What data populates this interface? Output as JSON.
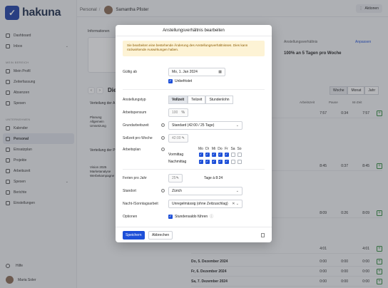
{
  "app": {
    "name": "hakuna"
  },
  "sidebar": {
    "items": [
      {
        "label": "Dashboard"
      },
      {
        "label": "Inbox"
      }
    ],
    "section_mine": "MEIN BEREICH",
    "mine_items": [
      {
        "label": "Mein Profil"
      },
      {
        "label": "Zeiterfassung"
      },
      {
        "label": "Absenzen"
      },
      {
        "label": "Spesen"
      }
    ],
    "section_company": "UNTERNEHMEN",
    "company_items": [
      {
        "label": "Kalender"
      },
      {
        "label": "Personal"
      },
      {
        "label": "Einsatzplan"
      },
      {
        "label": "Projekte"
      },
      {
        "label": "Arbeitszeit"
      },
      {
        "label": "Spesen"
      },
      {
        "label": "Berichte"
      },
      {
        "label": "Einstellungen"
      }
    ],
    "help": "Hilfe",
    "user": "Maria Soler"
  },
  "topbar": {
    "crumb_root": "Personal",
    "crumb_person": "Samantha Pfister",
    "actions": "Aktionen"
  },
  "background": {
    "tab": "Informationen",
    "section_right": "Anstellungsverhältnis",
    "edit_link": "Anpassen",
    "summary": "100% an 5 Tagen pro Woche",
    "view_week": "Woche",
    "view_month": "Monat",
    "view_year": "Jahr",
    "month_label": "Die",
    "col_work": "Arbeitszeit",
    "col_pause": "Pause",
    "col_actual": "Ist-Zeit",
    "dist_label_1": "Verteilung der A",
    "dist_label_2": "Verteilung der P",
    "legend1": [
      "Planung",
      "Allgemein",
      "Umsetzung"
    ],
    "legend2": [
      "Vision 2025",
      "Marketanalyse",
      "Werbekampagne"
    ],
    "rows": [
      {
        "w": "7:57",
        "p": "0:34",
        "i": "7:57"
      },
      {
        "w": "8:45",
        "p": "0:37",
        "i": "8:45"
      },
      {
        "w": "8:09",
        "p": "0:26",
        "i": "8:09"
      },
      {
        "w": "4:01",
        "p": "",
        "i": "4:01"
      }
    ],
    "days": [
      {
        "d": "Do, 5. Dezember 2024",
        "w": "0:00",
        "p": "0:00",
        "i": "0:00"
      },
      {
        "d": "Fr, 6. Dezember 2024",
        "w": "0:00",
        "p": "0:00",
        "i": "0:00"
      },
      {
        "d": "Sa, 7. Dezember 2024",
        "w": "0:00",
        "p": "0:00",
        "i": "0:00"
      }
    ]
  },
  "modal": {
    "title": "Anstellungsverhältnis bearbeiten",
    "warning": "Sie bearbeiten eine bestehende Änderung des Anstellungsverhältnisses. Dies kann rückwirkende Auswirkungen haben.",
    "valid_from_label": "Gültig ab",
    "valid_from_value": "Mo, 1. Jan 2024",
    "unlimited_label": "Unbefristet",
    "type_label": "Anstellungstyp",
    "type_options": [
      "Vollzeit",
      "Teilzeit",
      "Stundenlohn"
    ],
    "workload_label": "Arbeitspensum",
    "workload_value": "100",
    "workload_unit": "%",
    "base_time_label": "Grundarbeitszeit",
    "base_time_value": "Standard (42:00 / 25 Tage)",
    "target_label": "Sollzeit pro Woche",
    "target_value": "42:00",
    "schedule_label": "Arbeitsplan",
    "days": [
      "Mo",
      "Di",
      "Mi",
      "Do",
      "Fr",
      "Sa",
      "So"
    ],
    "morning": "Vormittag",
    "afternoon": "Nachmittag",
    "morning_checks": [
      true,
      true,
      true,
      true,
      true,
      false,
      false
    ],
    "afternoon_checks": [
      true,
      true,
      true,
      true,
      true,
      false,
      false
    ],
    "vacation_label": "Ferien pro Jahr",
    "vacation_value": "25",
    "vacation_hint": "Tage à 8:24",
    "location_label": "Standort",
    "location_value": "Zürich",
    "night_label": "Nacht-/Sonntagsarbeit",
    "night_value": "Unregelmässig (ohne Zeitzuschlag)",
    "options_label": "Optionen",
    "options_value": "Stundensaldo führen",
    "save": "Speichern",
    "cancel": "Abbrechen"
  }
}
